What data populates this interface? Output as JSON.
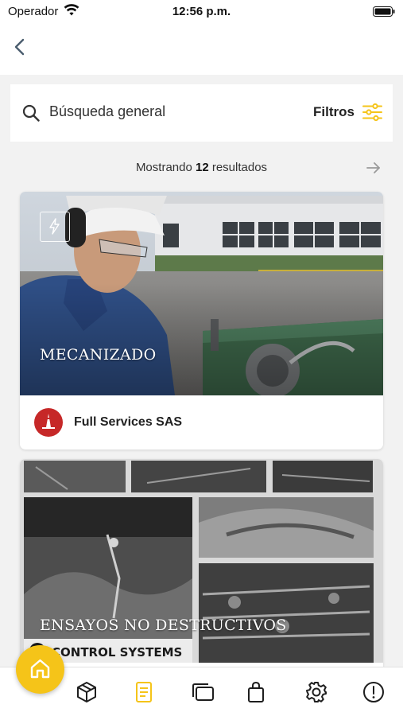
{
  "status_bar": {
    "carrier": "Operador",
    "time": "12:56 p.m."
  },
  "search": {
    "placeholder": "Búsqueda general",
    "filters_label": "Filtros"
  },
  "results": {
    "prefix": "Mostrando",
    "count": "12",
    "suffix": "resultados"
  },
  "cards": [
    {
      "title": "MECANIZADO",
      "company": "Full Services SAS",
      "badge_icon": "lightning-icon"
    },
    {
      "title": "ENSAYOS NO DESTRUCTIVOS",
      "image_text": "CONTROL SYSTEMS"
    }
  ],
  "tab_bar": {
    "items": [
      "home-icon",
      "box-icon",
      "document-icon",
      "cards-icon",
      "bag-icon",
      "gear-icon",
      "alert-icon"
    ],
    "active": "document-icon"
  },
  "colors": {
    "accent": "#f5c419",
    "brand_red": "#c62828",
    "background": "#f2f2f2"
  }
}
